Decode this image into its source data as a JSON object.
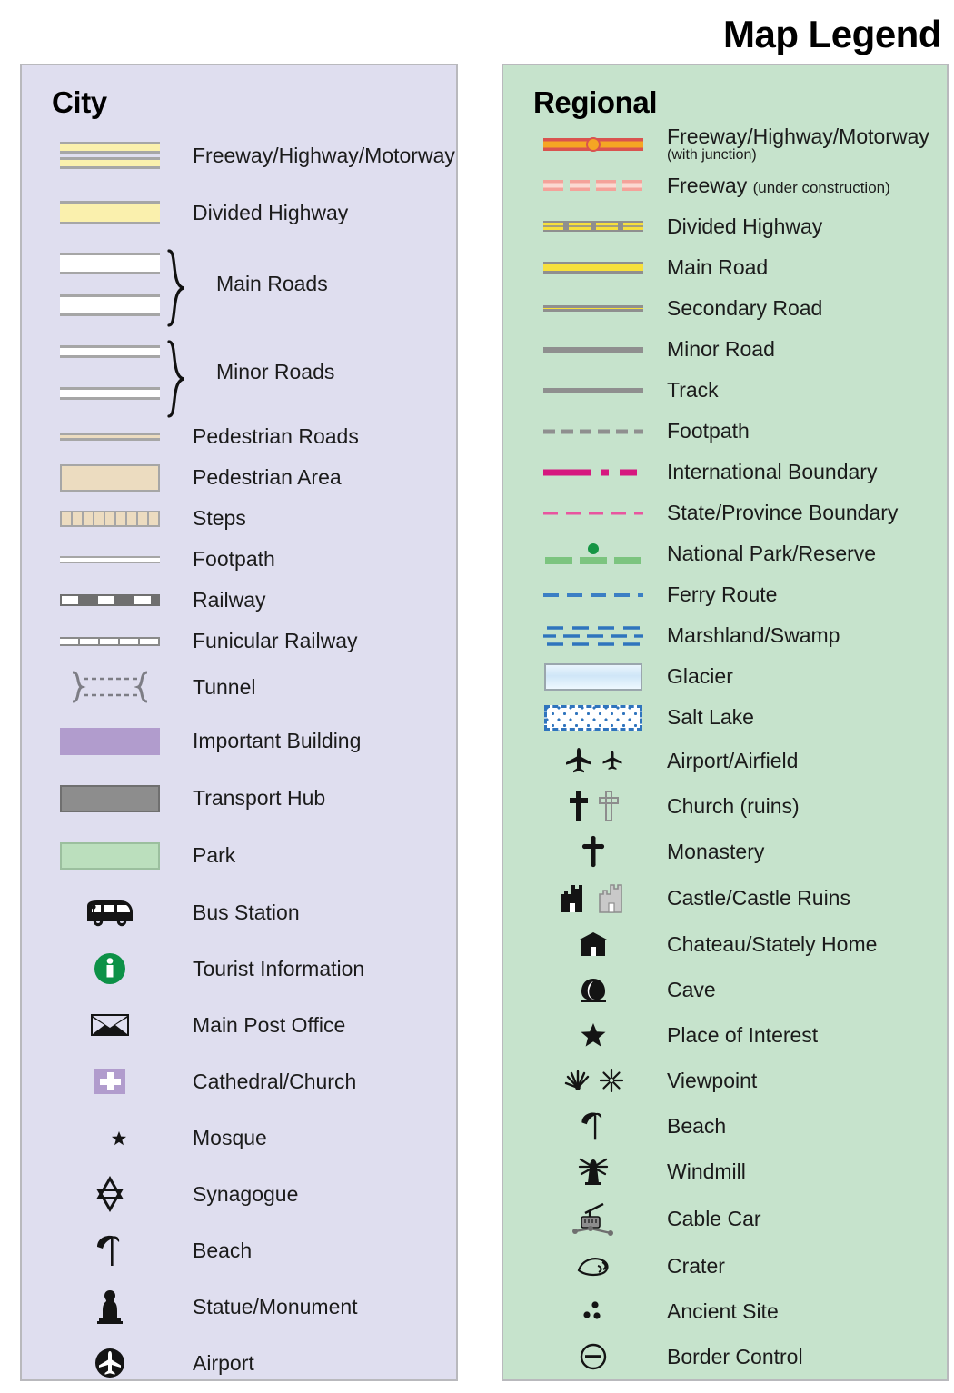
{
  "title": "Map Legend",
  "city": {
    "heading": "City",
    "items": [
      {
        "label": "Freeway/Highway/Motorway",
        "symbol": "freeway-double-yellow"
      },
      {
        "label": "Divided Highway",
        "symbol": "divided-highway-yellow"
      },
      {
        "label": "Main Roads",
        "symbol": "two-white-bars-brace"
      },
      {
        "label": "Minor Roads",
        "symbol": "two-thin-white-bars-brace"
      },
      {
        "label": "Pedestrian Roads",
        "symbol": "tan-thin-bar"
      },
      {
        "label": "Pedestrian Area",
        "symbol": "tan-block"
      },
      {
        "label": "Steps",
        "symbol": "steps-segments"
      },
      {
        "label": "Footpath",
        "symbol": "thin-white-line"
      },
      {
        "label": "Railway",
        "symbol": "railway-hatched"
      },
      {
        "label": "Funicular Railway",
        "symbol": "funicular-ticks"
      },
      {
        "label": "Tunnel",
        "symbol": "tunnel-brackets-dashed"
      },
      {
        "label": "Important Building",
        "symbol": "purple-block"
      },
      {
        "label": "Transport Hub",
        "symbol": "gray-block"
      },
      {
        "label": "Park",
        "symbol": "green-block"
      },
      {
        "label": "Bus Station",
        "symbol": "bus-icon"
      },
      {
        "label": "Tourist Information",
        "symbol": "information-circle-icon"
      },
      {
        "label": "Main Post Office",
        "symbol": "envelope-icon"
      },
      {
        "label": "Cathedral/Church",
        "symbol": "cross-on-purple-square-icon"
      },
      {
        "label": "Mosque",
        "symbol": "crescent-star-icon"
      },
      {
        "label": "Synagogue",
        "symbol": "star-of-david-icon"
      },
      {
        "label": "Beach",
        "symbol": "beach-umbrella-icon"
      },
      {
        "label": "Statue/Monument",
        "symbol": "statue-icon"
      },
      {
        "label": "Airport",
        "symbol": "airplane-circle-icon"
      }
    ]
  },
  "regional": {
    "heading": "Regional",
    "items": [
      {
        "label": "Freeway/Highway/Motorway",
        "sublabel": "(with junction)",
        "sub_style": "block",
        "symbol": "freeway-red-with-junction"
      },
      {
        "label": "Freeway",
        "sublabel": "(under construction)",
        "sub_style": "inline",
        "symbol": "freeway-dashed-pink"
      },
      {
        "label": "Divided Highway",
        "symbol": "divided-highway-dashed-yellow"
      },
      {
        "label": "Main Road",
        "symbol": "main-road-yellow"
      },
      {
        "label": "Secondary Road",
        "symbol": "secondary-road-yellow-thin"
      },
      {
        "label": "Minor Road",
        "symbol": "minor-road-cream"
      },
      {
        "label": "Track",
        "symbol": "track-gray-line"
      },
      {
        "label": "Footpath",
        "symbol": "footpath-gray-dashed"
      },
      {
        "label": "International Boundary",
        "symbol": "boundary-magenta-dashdot"
      },
      {
        "label": "State/Province Boundary",
        "symbol": "boundary-pink-dashed"
      },
      {
        "label": "National Park/Reserve",
        "symbol": "national-park-green-dashed-dot"
      },
      {
        "label": "Ferry Route",
        "symbol": "ferry-blue-dashed"
      },
      {
        "label": "Marshland/Swamp",
        "symbol": "marshland-blue-dashes"
      },
      {
        "label": "Glacier",
        "symbol": "glacier-gradient-block"
      },
      {
        "label": "Salt Lake",
        "symbol": "salt-lake-dotted-block"
      },
      {
        "label": "Airport/Airfield",
        "symbol": "airplane-pair-icon"
      },
      {
        "label": "Church (ruins)",
        "symbol": "cross-pair-icon"
      },
      {
        "label": "Monastery",
        "symbol": "ornate-cross-icon"
      },
      {
        "label": "Castle/Castle Ruins",
        "symbol": "castle-pair-icon"
      },
      {
        "label": "Chateau/Stately Home",
        "symbol": "chateau-icon"
      },
      {
        "label": "Cave",
        "symbol": "cave-icon"
      },
      {
        "label": "Place of Interest",
        "symbol": "star-icon"
      },
      {
        "label": "Viewpoint",
        "symbol": "viewpoint-pair-icon"
      },
      {
        "label": "Beach",
        "symbol": "beach-umbrella-icon"
      },
      {
        "label": "Windmill",
        "symbol": "windmill-icon"
      },
      {
        "label": "Cable Car",
        "symbol": "cable-car-icon"
      },
      {
        "label": "Crater",
        "symbol": "crater-icon"
      },
      {
        "label": "Ancient Site",
        "symbol": "ancient-site-dots-icon"
      },
      {
        "label": "Border Control",
        "symbol": "border-control-icon"
      }
    ]
  },
  "colors": {
    "city_panel_bg": "#dfdeef",
    "regional_panel_bg": "#c6e3cc",
    "panel_border": "#b9b9bd",
    "road_yellow": "#faf0ad",
    "road_yellow_strong": "#f7e03c",
    "tan": "#ecdcc0",
    "purple_building": "#b19ccd",
    "gray_hub": "#8d8d8d",
    "park_green": "#bbdfbd",
    "freeway_red": "#d9534f",
    "freeway_orange": "#f5a623",
    "boundary_magenta": "#d6187f",
    "boundary_pink": "#e8559f",
    "park_line_green": "#7cc47f",
    "ferry_blue": "#3b7fc4",
    "glacier_blue": "#cfe6f7",
    "text": "#1b1b1b"
  }
}
